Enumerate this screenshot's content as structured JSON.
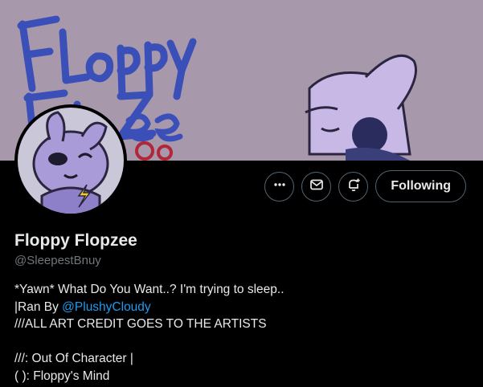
{
  "profile": {
    "display_name": "Floppy Flopzee",
    "handle": "@SleepestBnuy",
    "banner_text": "Floppy Flopzee"
  },
  "actions": {
    "more_icon": "more-horizontal-icon",
    "message_icon": "envelope-icon",
    "notify_icon": "bell-plus-icon",
    "follow_label": "Following"
  },
  "bio": {
    "line1": "*Yawn* What Do You Want..? I'm trying to sleep..",
    "line2_prefix": "|Ran By ",
    "line2_mention": "@PlushyCloudy",
    "line3": "///ALL ART CREDIT GOES TO THE ARTISTS",
    "line4": "",
    "line5": "///: Out Of Character |",
    "line6": "( ): Floppy's Mind"
  },
  "colors": {
    "background": "#000000",
    "banner": "#a798ab",
    "text": "#e7e9ea",
    "muted": "#71767b",
    "link": "#1d9bf0",
    "border": "#536471"
  }
}
